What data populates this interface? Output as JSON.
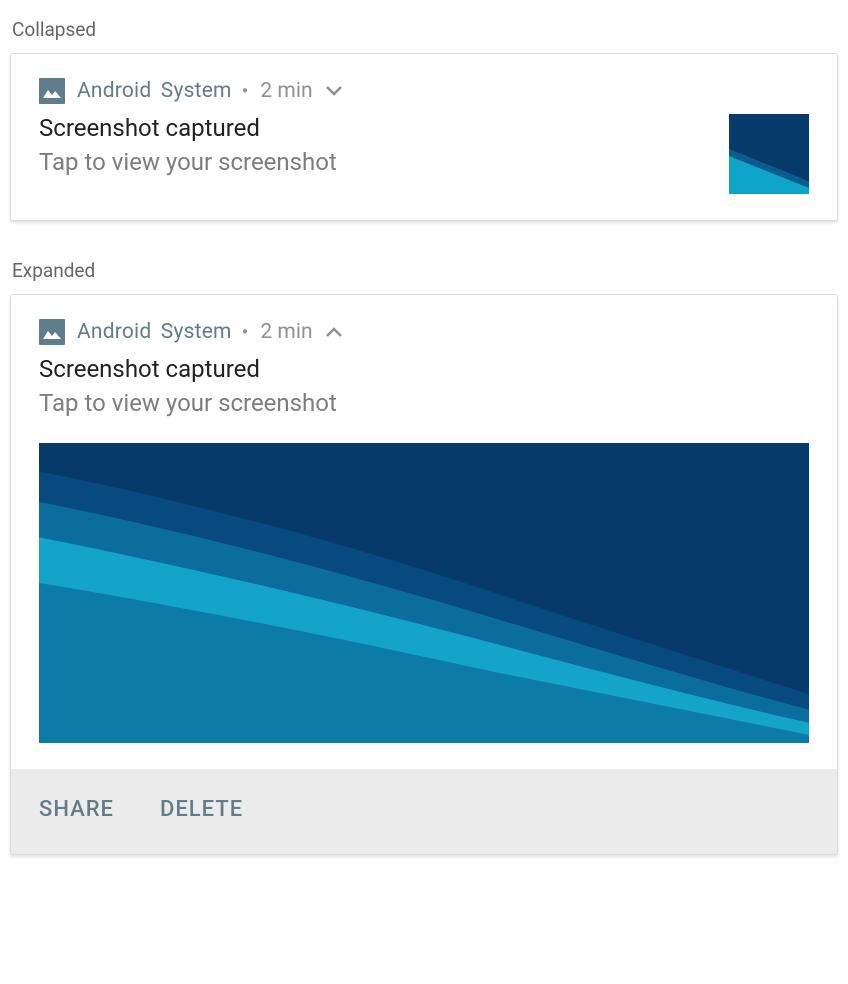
{
  "sections": {
    "collapsed_label": "Collapsed",
    "expanded_label": "Expanded"
  },
  "notification": {
    "app_name": "Android  System",
    "separator": "•",
    "timestamp": "2 min",
    "title": "Screenshot captured",
    "body": "Tap to view your screenshot"
  },
  "actions": {
    "share": "SHARE",
    "delete": "DELETE"
  },
  "icons": {
    "app_icon": "image-icon",
    "chevron_down": "chevron-down-icon",
    "chevron_up": "chevron-up-icon"
  },
  "colors": {
    "accent": "#607d8b",
    "image_dark": "#063a6b",
    "image_light": "#0ea5c9"
  }
}
